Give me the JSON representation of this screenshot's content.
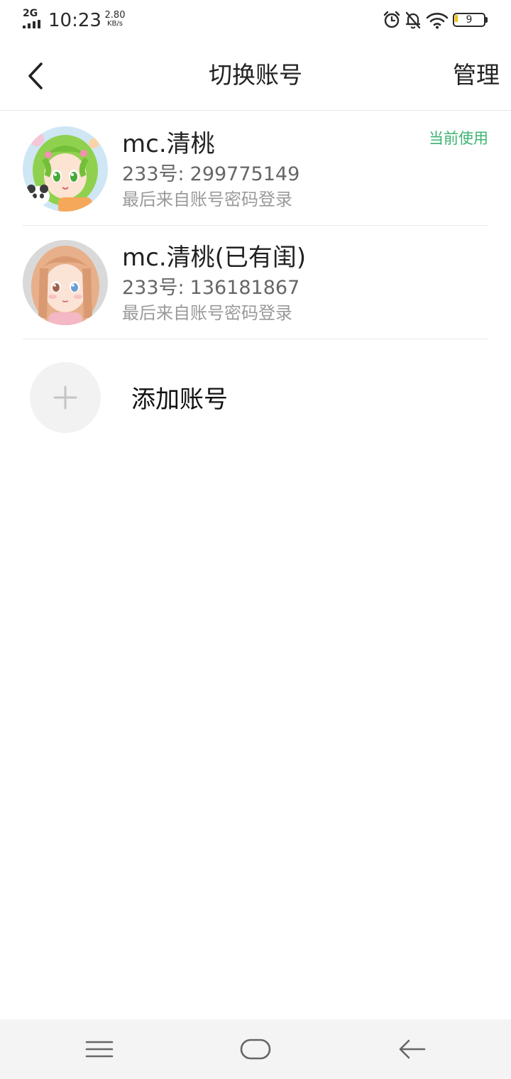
{
  "status_bar": {
    "network": "2G",
    "time": "10:23",
    "speed_value": "2.80",
    "speed_unit": "KB/s",
    "icons": [
      "alarm-icon",
      "bell-off-icon",
      "wifi-icon"
    ],
    "battery": "9",
    "battery_color": "#f2c200"
  },
  "header": {
    "back_icon": "chevron-left-icon",
    "title": "切换账号",
    "manage_label": "管理"
  },
  "accounts": [
    {
      "name": "mc.清桃",
      "id_label": "233号:",
      "id": "299775149",
      "login_source": "最后来自账号密码登录",
      "badge": "当前使用",
      "avatar": "green-hair-anime-avatar"
    },
    {
      "name": "mc.清桃(已有闺)",
      "id_label": "233号:",
      "id": "136181867",
      "login_source": "最后来自账号密码登录",
      "avatar": "brown-hair-anime-avatar"
    }
  ],
  "add_account": {
    "label": "添加账号",
    "icon": "plus-icon"
  },
  "nav_bar": {
    "icons": [
      "menu-icon",
      "home-icon",
      "back-arrow-icon"
    ]
  },
  "colors": {
    "accent_green": "#3cb371",
    "secondary_text": "#666666",
    "tertiary_text": "#9a9a9a"
  }
}
